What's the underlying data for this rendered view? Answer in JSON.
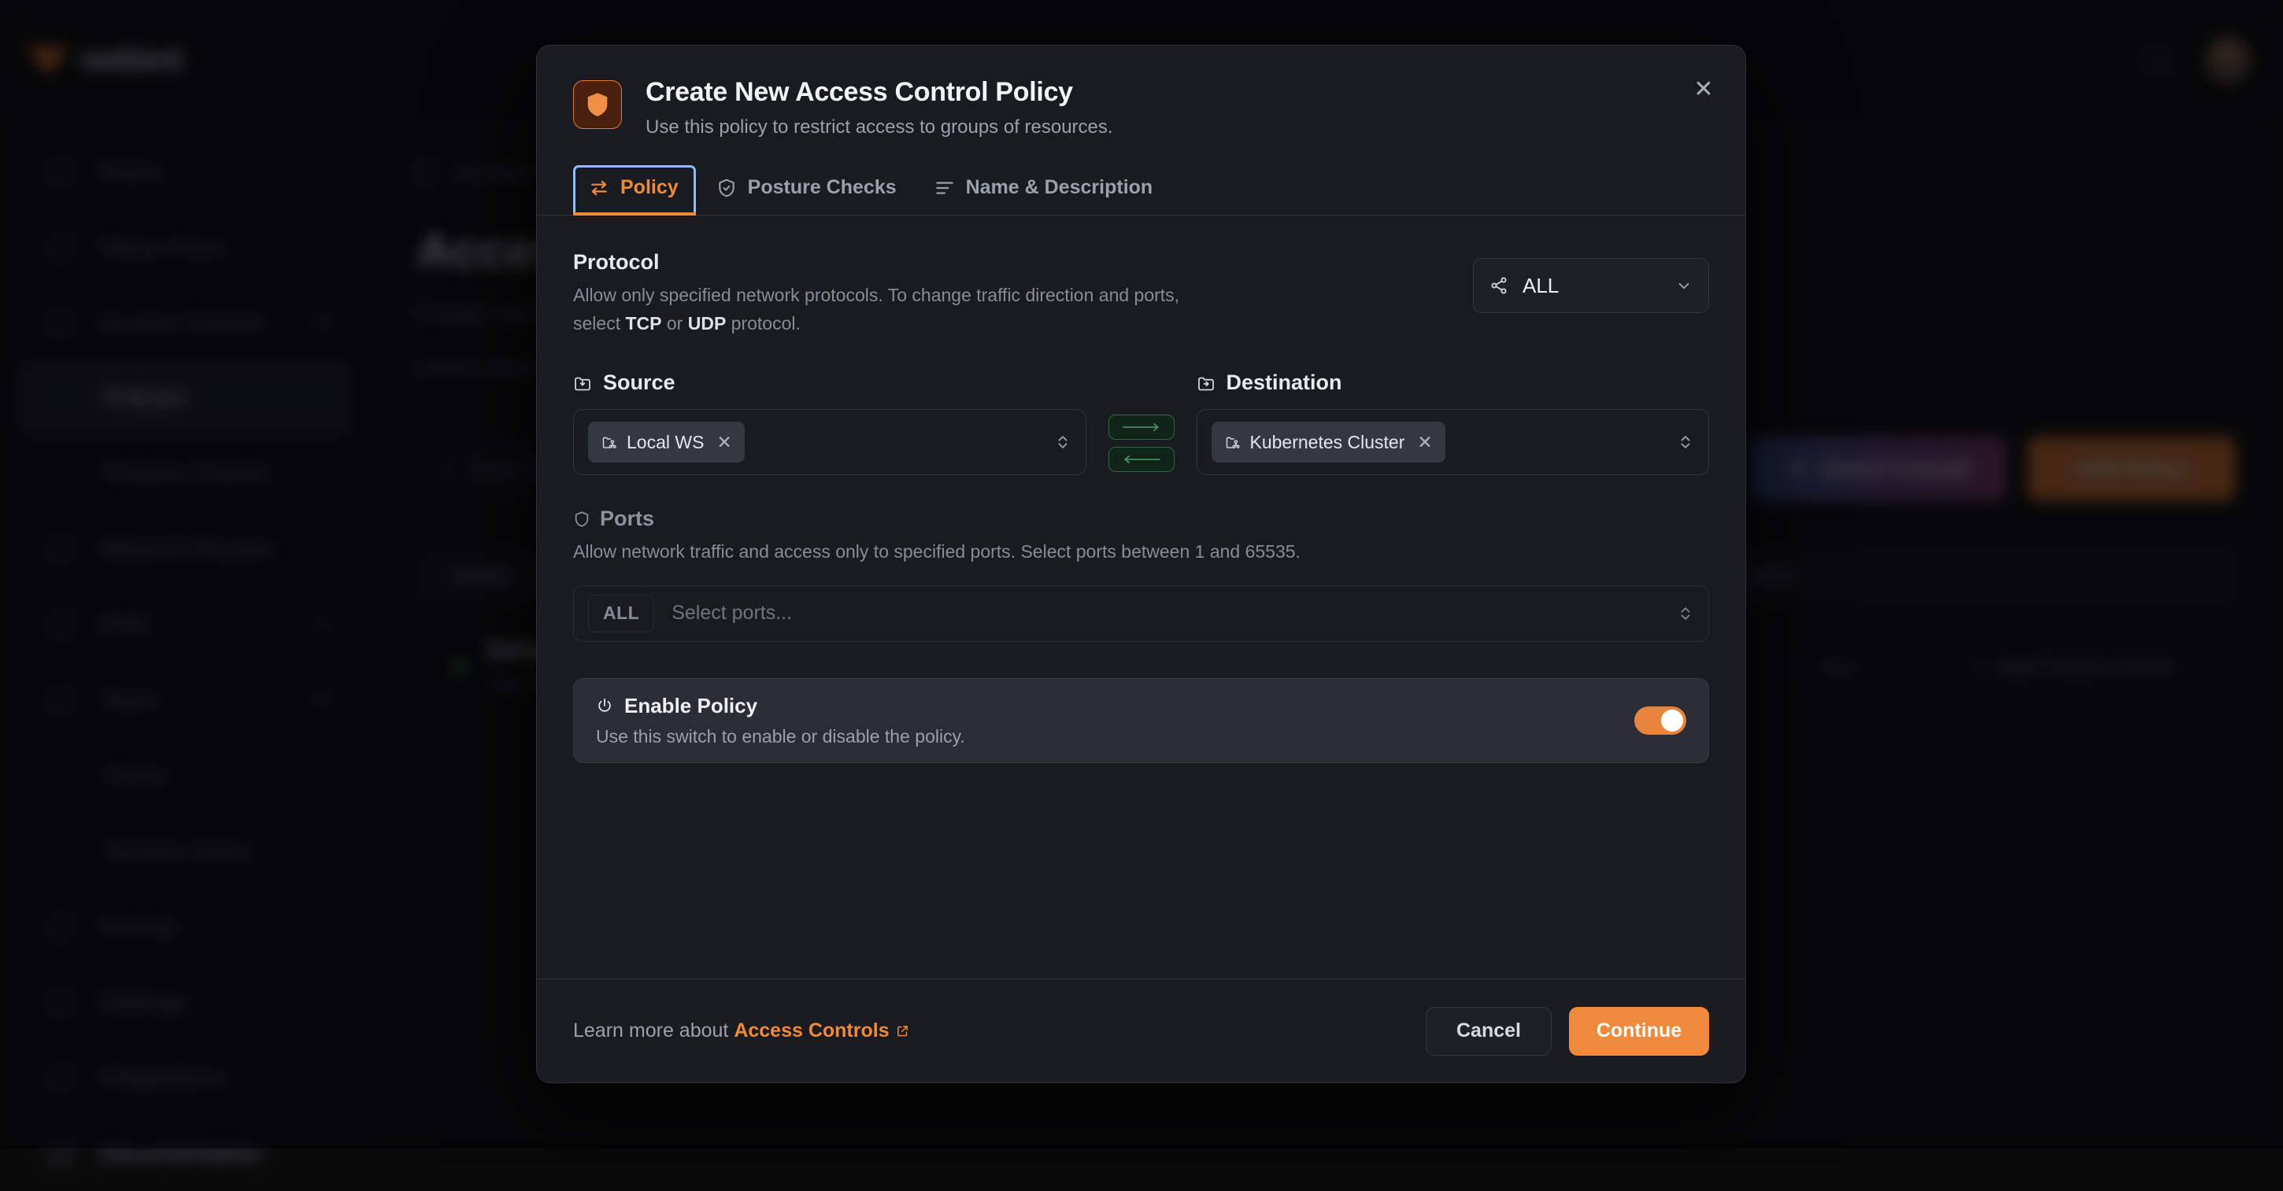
{
  "background": {
    "brand": "netbird",
    "nav": [
      {
        "label": "Peers",
        "badge": "",
        "sub": false,
        "active": false
      },
      {
        "label": "Setup Keys",
        "badge": "",
        "sub": false,
        "active": false
      },
      {
        "label": "Access Control",
        "badge": "20",
        "sub": false,
        "active": false
      },
      {
        "label": "Policies",
        "badge": "",
        "sub": true,
        "active": true
      },
      {
        "label": "Posture Checks",
        "badge": "",
        "sub": true,
        "active": false
      },
      {
        "label": "Network Routes",
        "badge": "",
        "sub": false,
        "active": false
      },
      {
        "label": "DNS",
        "badge": "12",
        "sub": false,
        "active": false
      },
      {
        "label": "Team",
        "badge": "45",
        "sub": false,
        "active": false
      },
      {
        "label": "Users",
        "badge": "",
        "sub": true,
        "active": false
      },
      {
        "label": "Service Users",
        "badge": "",
        "sub": true,
        "active": false
      },
      {
        "label": "Activity",
        "badge": "",
        "sub": false,
        "active": false
      },
      {
        "label": "Settings",
        "badge": "",
        "sub": false,
        "active": false
      },
      {
        "label": "Integrations",
        "badge": "",
        "sub": false,
        "active": false
      },
      {
        "label": "Documentation",
        "badge": "",
        "sub": false,
        "active": false
      }
    ],
    "breadcrumb": "Access Control",
    "page_title": "Access Control",
    "page_subtitle_1": "Create und manage rules to control access between peers.",
    "page_subtitle_2": "Learn more",
    "search_placeholder": "Search by name...",
    "ai_button": "Smart Firewall",
    "new_button": "Add Policy",
    "table_headers": [
      "NAME",
      "ACTIVE",
      "PROTOCOL",
      "PORTS",
      "POSTURE CHECKS"
    ],
    "row_name": "Default",
    "row_desc": "This is a default rule that allows connections between all the resources",
    "row_pill_1": "ALL",
    "row_pill_2": "Add Posture Check"
  },
  "modal": {
    "title": "Create New Access Control Policy",
    "description": "Use this policy to restrict access to groups of resources.",
    "close_label": "✕",
    "tabs": [
      {
        "label": "Policy",
        "icon": "transfer-icon",
        "active": true
      },
      {
        "label": "Posture Checks",
        "icon": "shield-check-icon",
        "active": false
      },
      {
        "label": "Name & Description",
        "icon": "lines-icon",
        "active": false
      }
    ],
    "protocol": {
      "title": "Protocol",
      "desc_part1": "Allow only specified network protocols. To change traffic direction and ports, select ",
      "desc_tcp": "TCP",
      "desc_or": " or ",
      "desc_udp": "UDP",
      "desc_part2": " protocol.",
      "selected": "ALL"
    },
    "source": {
      "label": "Source",
      "chips": [
        "Local WS"
      ]
    },
    "destination": {
      "label": "Destination",
      "chips": [
        "Kubernetes Cluster"
      ]
    },
    "direction": {
      "out_label": "allow-outbound",
      "in_label": "allow-inbound"
    },
    "ports": {
      "title": "Ports",
      "desc": "Allow network traffic and access only to specified ports. Select ports between 1 and 65535.",
      "badge": "ALL",
      "placeholder": "Select ports..."
    },
    "enable": {
      "title": "Enable Policy",
      "desc": "Use this switch to enable or disable the policy.",
      "state": "on"
    },
    "footer": {
      "learn_prefix": "Learn more about",
      "learn_link": "Access Controls",
      "cancel": "Cancel",
      "continue": "Continue"
    }
  },
  "colors": {
    "accent": "#ef8a3c",
    "modal_bg": "#1a1b20",
    "card_bg": "#2a2d35",
    "green": "#2f6b42",
    "focus_ring": "#93bdf0"
  }
}
